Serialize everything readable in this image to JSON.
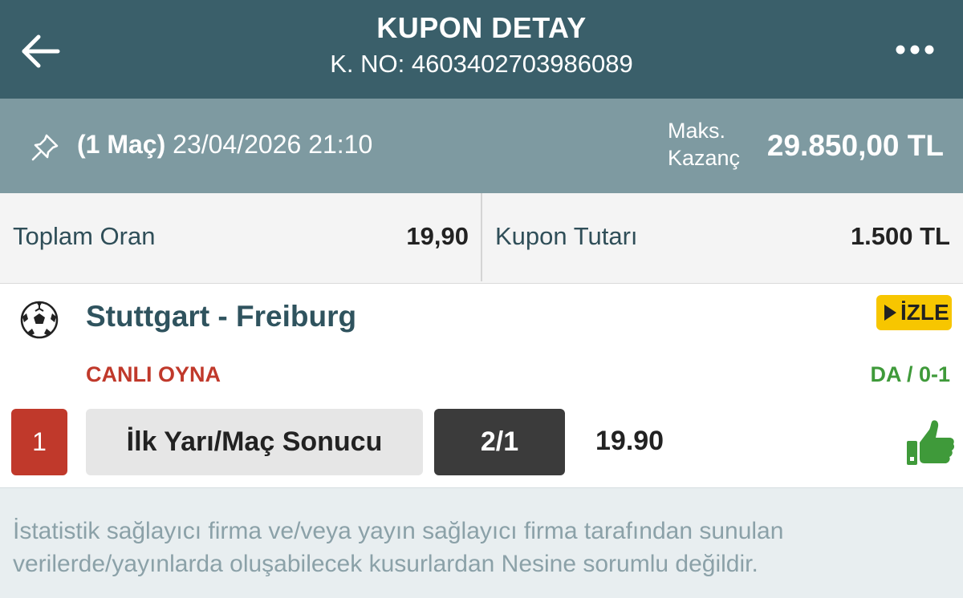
{
  "header": {
    "title": "KUPON DETAY",
    "coupon_no": "K. NO: 4603402703986089",
    "back_icon": "arrow-left-icon",
    "more_icon": "more-horizontal-icon"
  },
  "summary": {
    "match_count": "(1 Maç)",
    "datetime": "23/04/2026 21:10",
    "max_label_line1": "Maks.",
    "max_label_line2": "Kazanç",
    "max_value": "29.850,00 TL",
    "pin_icon": "pin-icon"
  },
  "stats": {
    "total_odds_label": "Toplam Oran",
    "total_odds_value": "19,90",
    "stake_label": "Kupon Tutarı",
    "stake_value": "1.500 TL"
  },
  "match": {
    "sport_icon": "soccer-ball-icon",
    "title": "Stuttgart - Freiburg",
    "watch_label": "İZLE",
    "live_label": "CANLI OYNA",
    "score": "DA / 0-1",
    "row_number": "1",
    "market": "İlk Yarı/Maç Sonucu",
    "pick": "2/1",
    "odds": "19.90",
    "status_icon": "thumbs-up-icon"
  },
  "footer": {
    "disclaimer": "İstatistik sağlayıcı firma ve/veya yayın sağlayıcı firma tarafından sunulan verilerde/yayınlarda oluşabilecek kusurlardan Nesine sorumlu değildir."
  },
  "colors": {
    "header_bg": "#3a5f6a",
    "summary_bg": "#7e9aa1",
    "accent_red": "#c0392b",
    "accent_green": "#3f9a3a",
    "watch_yellow": "#f7c600"
  }
}
